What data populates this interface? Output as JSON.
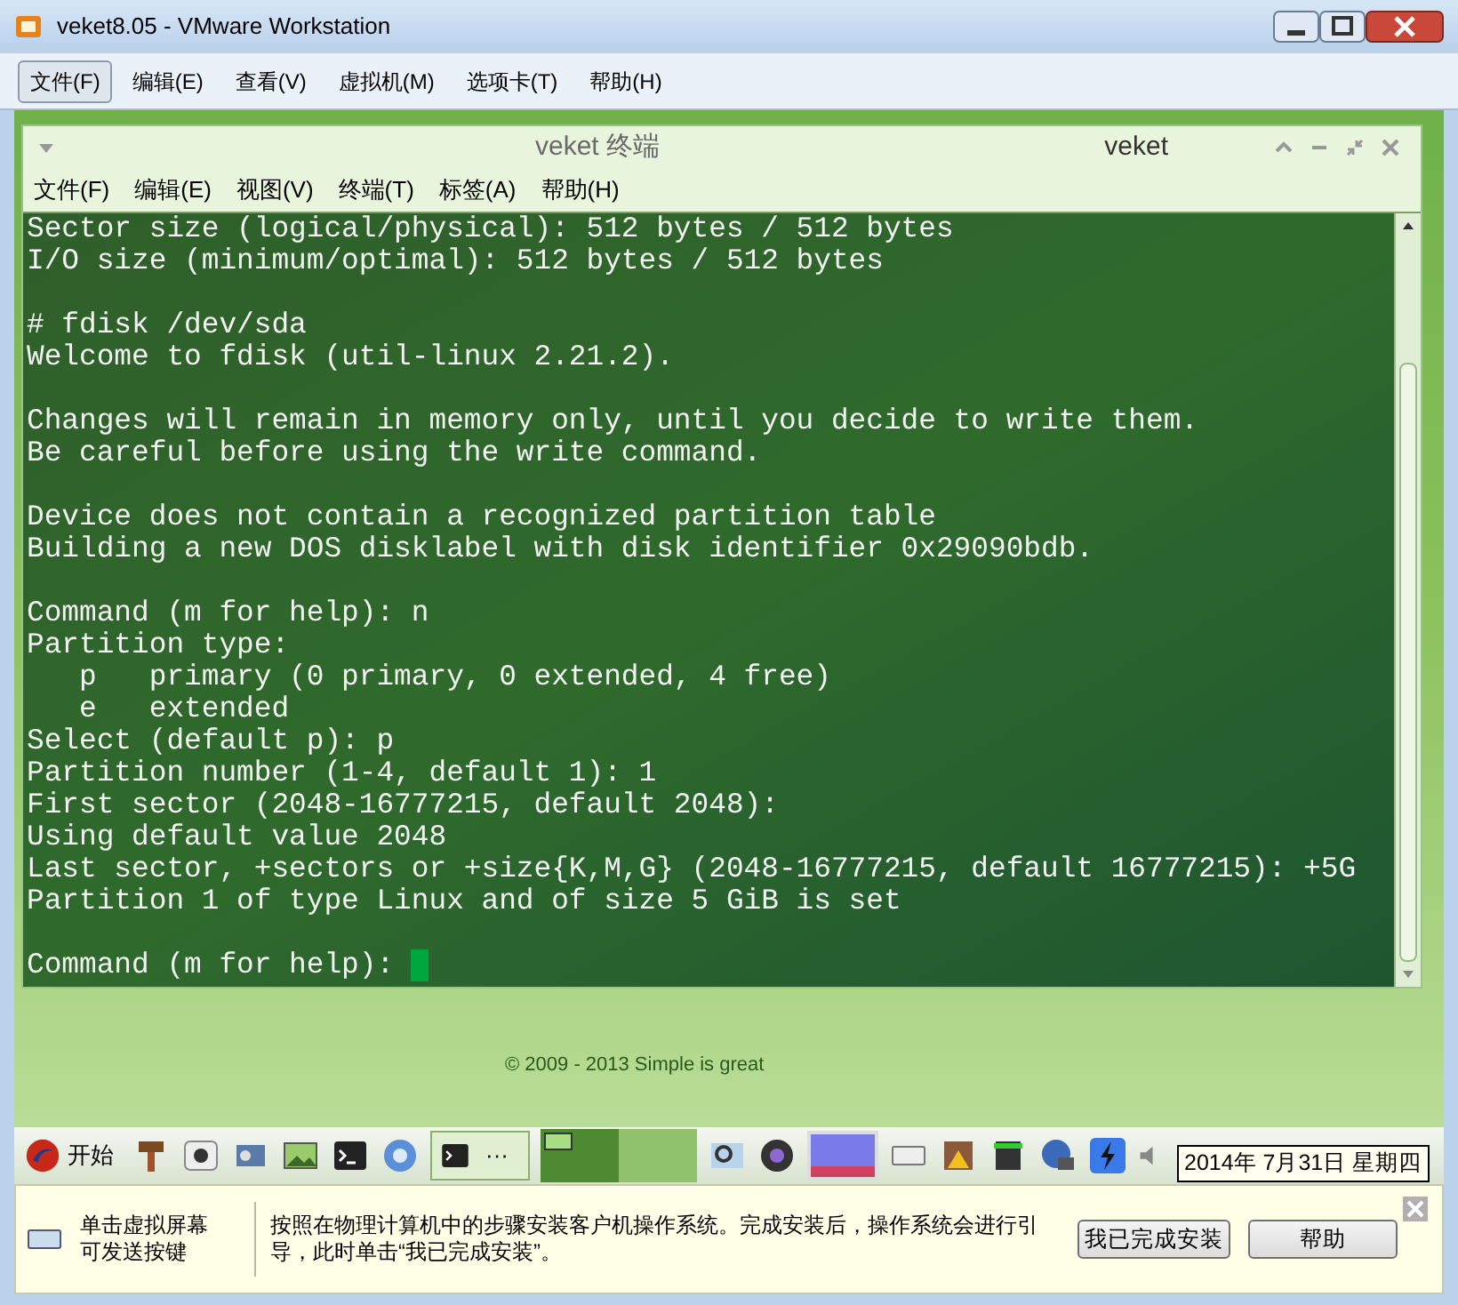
{
  "window": {
    "title": "veket8.05 - VMware Workstation"
  },
  "menu": [
    {
      "label": "文件(F)",
      "selected": true
    },
    {
      "label": "编辑(E)",
      "selected": false
    },
    {
      "label": "查看(V)",
      "selected": false
    },
    {
      "label": "虚拟机(M)",
      "selected": false
    },
    {
      "label": "选项卡(T)",
      "selected": false
    },
    {
      "label": "帮助(H)",
      "selected": false
    }
  ],
  "terminal": {
    "title": "veket 终端",
    "host": "veket",
    "menu": [
      "文件(F)",
      "编辑(E)",
      "视图(V)",
      "终端(T)",
      "标签(A)",
      "帮助(H)"
    ],
    "blocks": [
      [
        "Sector size (logical/physical): 512 bytes / 512 bytes",
        "I/O size (minimum/optimal): 512 bytes / 512 bytes"
      ],
      [
        "# fdisk /dev/sda",
        "Welcome to fdisk (util-linux 2.21.2)."
      ],
      [
        "Changes will remain in memory only, until you decide to write them.",
        "Be careful before using the write command."
      ],
      [
        "Device does not contain a recognized partition table",
        "Building a new DOS disklabel with disk identifier 0x29090bdb."
      ],
      [
        "Command (m for help): n",
        "Partition type:",
        "   p   primary (0 primary, 0 extended, 4 free)",
        "   e   extended",
        "Select (default p): p",
        "Partition number (1-4, default 1): 1",
        "First sector (2048-16777215, default 2048):",
        "Using default value 2048",
        "Last sector, +sectors or +size{K,M,G} (2048-16777215, default 16777215): +5G",
        "Partition 1 of type Linux and of size 5 GiB is set"
      ],
      [
        "Command (m for help): "
      ]
    ],
    "cursor": true
  },
  "desktop": {
    "copyright": "© 2009 - 2013 Simple is great"
  },
  "taskbar": {
    "start": "开始",
    "task": "···",
    "workspaces": [
      {
        "selected": true
      },
      {
        "selected": false
      }
    ],
    "clock": "2014年 7月31日 星期四"
  },
  "hint": {
    "keyboard_tip": [
      "单击虚拟屏幕",
      "可发送按键"
    ],
    "message": "按照在物理计算机中的步骤安装客户机操作系统。完成安装后，操作系统会进行引导，此时单击“我已完成安装”。",
    "buttons": [
      "我已完成安装",
      "帮助"
    ]
  }
}
